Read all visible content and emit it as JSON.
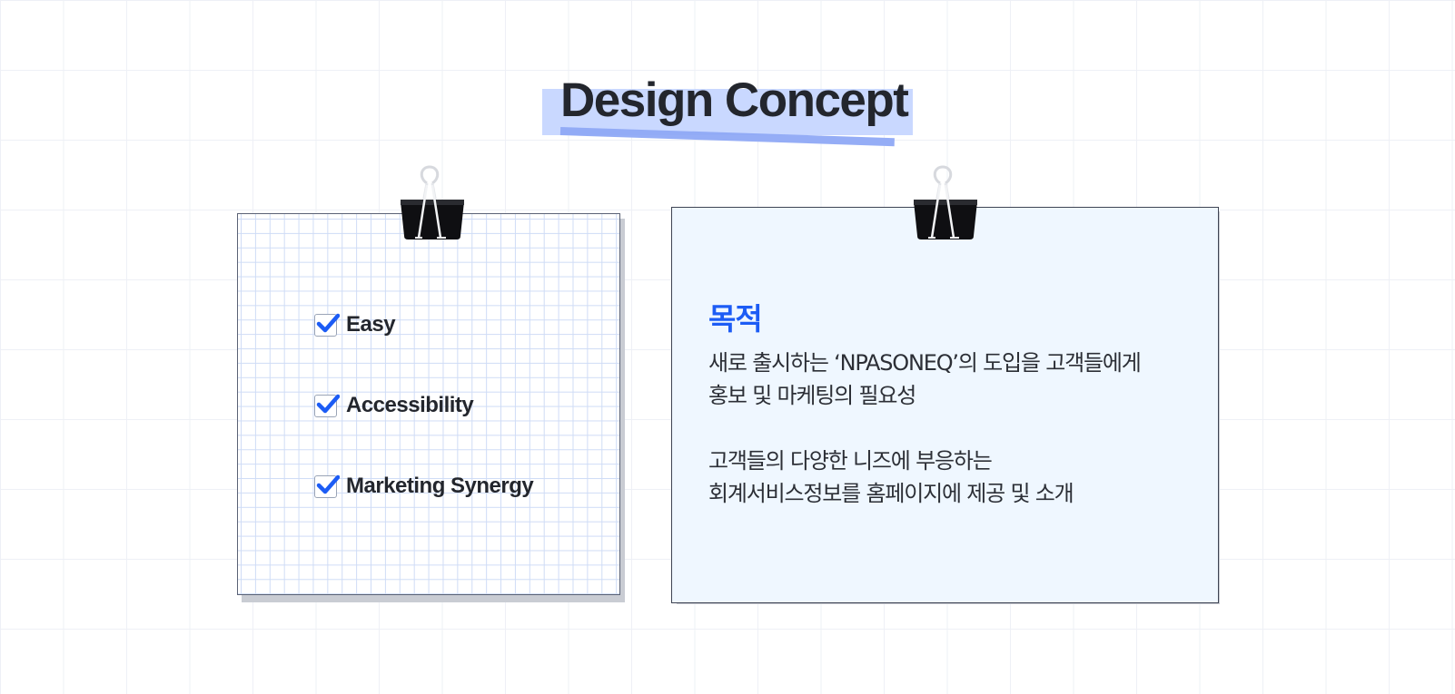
{
  "title": "Design Concept",
  "checklist": {
    "items": [
      {
        "label": "Easy",
        "checked": true
      },
      {
        "label": "Accessibility",
        "checked": true
      },
      {
        "label": "Marketing Synergy",
        "checked": true
      }
    ]
  },
  "purpose": {
    "heading": "목적",
    "paragraphs": [
      {
        "line1": "새로 출시하는 ‘NPASONEQ’의 도입을 고객들에게",
        "line2": "홍보 및 마케팅의 필요성"
      },
      {
        "line1": "고객들의 다양한 니즈에 부응하는",
        "line2": "회계서비스정보를 홈페이지에 제공 및 소개"
      }
    ]
  },
  "icons": {
    "clip": "binder-clip-icon",
    "check": "checkmark-icon"
  },
  "colors": {
    "accent": "#1c5cf5",
    "title_highlight": "#c9d8ff",
    "title_underline": "#8fa9f6",
    "card_background": "#eff7ff",
    "text": "#23262d"
  }
}
